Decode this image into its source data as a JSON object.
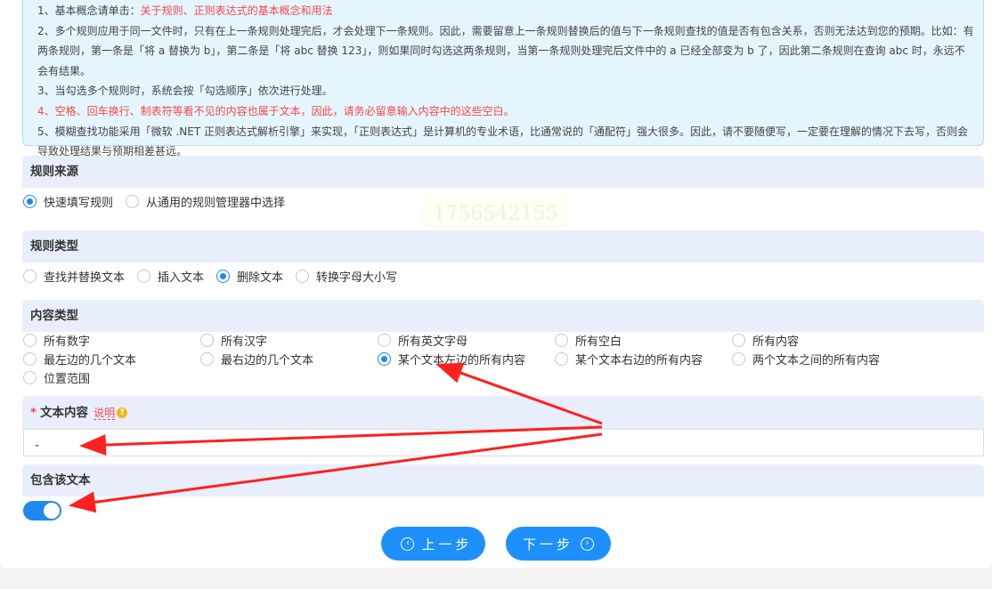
{
  "notes": {
    "n1_prefix": "1、基本概念请单击：",
    "n1_link": "关于规则、正则表达式的基本概念和用法",
    "n2": "2、多个规则应用于同一文件时，只有在上一条规则处理完后，才会处理下一条规则。因此，需要留意上一条规则替换后的值与下一条规则查找的值是否有包含关系，否则无法达到您的预期。比如：有两条规则，第一条是「将 a 替换为 b」，第二条是「将 abc 替换 123」，则如果同时勾选这两条规则，当第一条规则处理完后文件中的 a 已经全部变为 b 了，因此第二条规则在查询 abc 时，永远不会有结果。",
    "n3": "3、当勾选多个规则时，系统会按「勾选顺序」依次进行处理。",
    "n4": "4、空格、回车换行、制表符等看不见的内容也属于文本，因此，请务必留意输入内容中的这些空白。",
    "n5": "5、模糊查找功能采用「微软 .NET 正则表达式解析引擎」来实现，「正则表达式」是计算机的专业术语，比通常说的「通配符」强大很多。因此，请不要随便写，一定要在理解的情况下去写，否则会导致处理结果与预期相差甚远。"
  },
  "watermark": "1756542155",
  "rule_source": {
    "title": "规则来源",
    "options": [
      {
        "label": "快速填写规则",
        "checked": true
      },
      {
        "label": "从通用的规则管理器中选择",
        "checked": false
      }
    ]
  },
  "rule_type": {
    "title": "规则类型",
    "options": [
      {
        "label": "查找并替换文本",
        "checked": false
      },
      {
        "label": "插入文本",
        "checked": false
      },
      {
        "label": "删除文本",
        "checked": true
      },
      {
        "label": "转换字母大小写",
        "checked": false
      }
    ]
  },
  "content_type": {
    "title": "内容类型",
    "options": [
      {
        "label": "所有数字",
        "checked": false
      },
      {
        "label": "所有汉字",
        "checked": false
      },
      {
        "label": "所有英文字母",
        "checked": false
      },
      {
        "label": "所有空白",
        "checked": false
      },
      {
        "label": "所有内容",
        "checked": false
      },
      {
        "label": "最左边的几个文本",
        "checked": false
      },
      {
        "label": "最右边的几个文本",
        "checked": false
      },
      {
        "label": "某个文本左边的所有内容",
        "checked": true
      },
      {
        "label": "某个文本右边的所有内容",
        "checked": false
      },
      {
        "label": "两个文本之间的所有内容",
        "checked": false
      },
      {
        "label": "位置范围",
        "checked": false
      }
    ]
  },
  "text_content": {
    "required_mark": "*",
    "title": "文本内容",
    "help": "说明",
    "help_icon": "?",
    "value": "-"
  },
  "include_text": {
    "title": "包含该文本",
    "on": true
  },
  "buttons": {
    "prev": "上一步",
    "next": "下一步",
    "prev_icon": "‹",
    "next_icon": "›"
  },
  "colors": {
    "accent": "#1e88f0",
    "warning": "#f5484a",
    "arrow": "#ff2020"
  }
}
